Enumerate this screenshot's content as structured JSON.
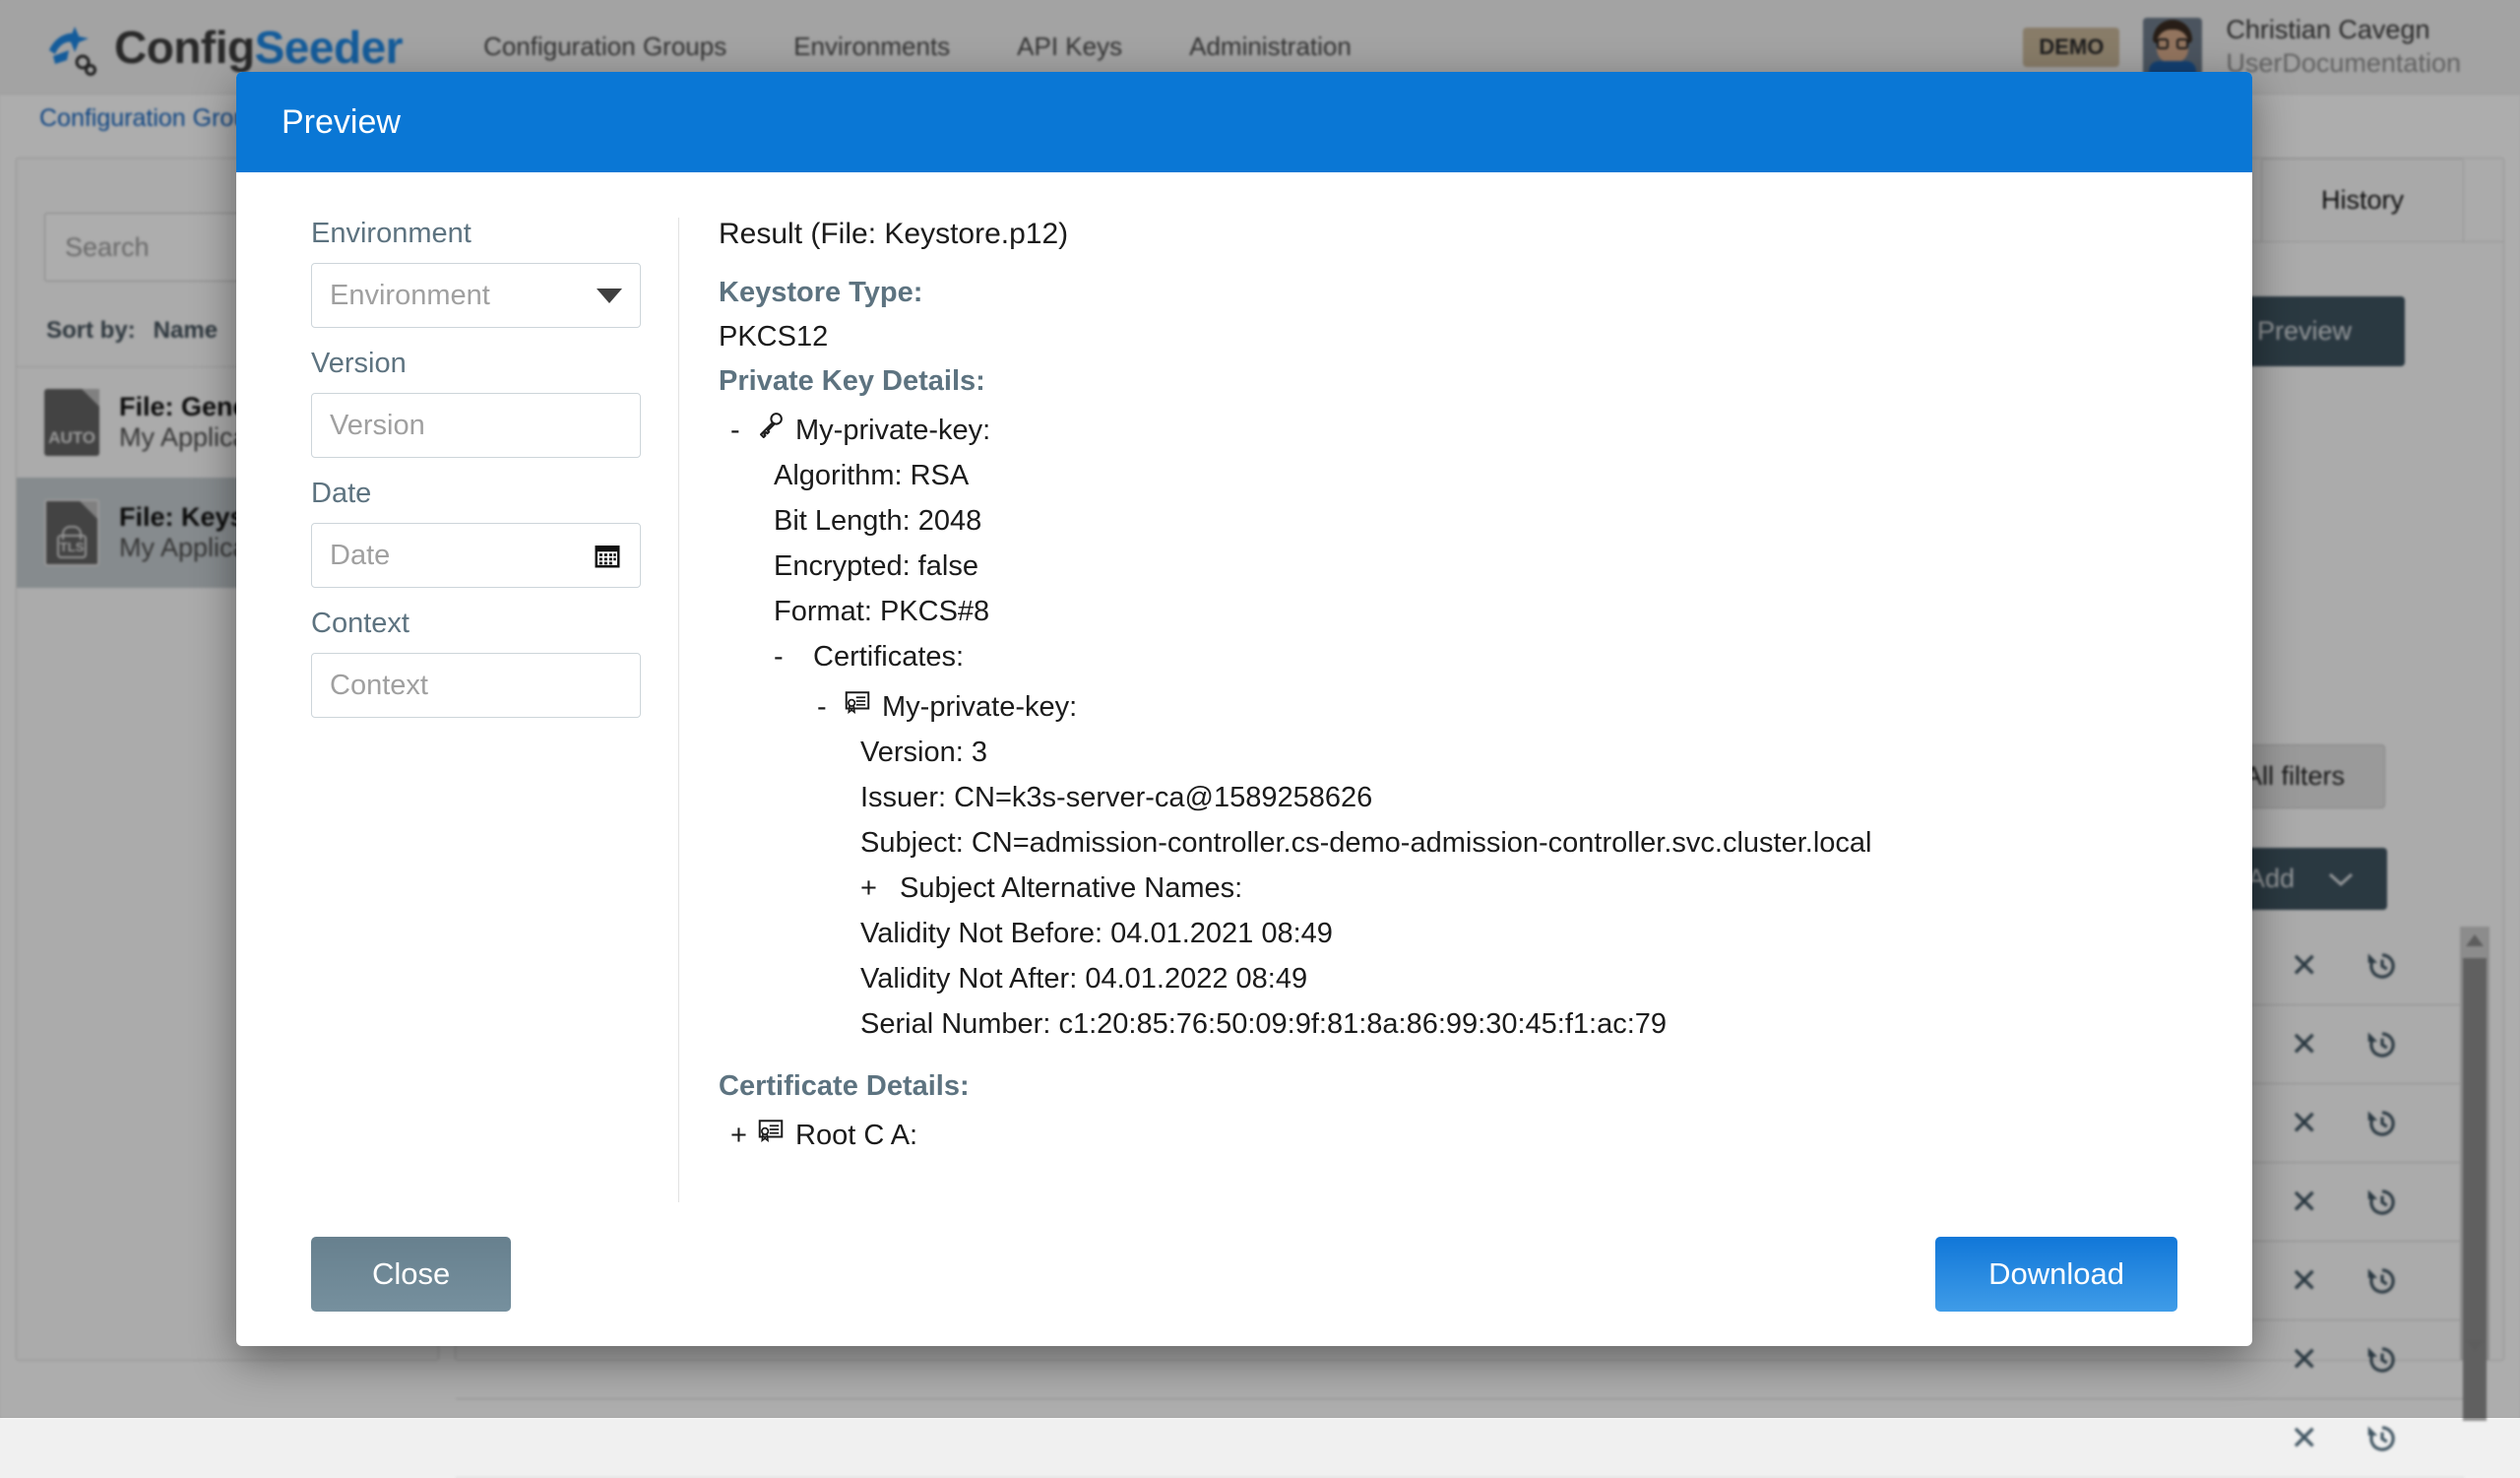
{
  "header": {
    "brand_primary": "Config",
    "brand_secondary": "Seeder",
    "logo_icon": "configseeder-logo-icon",
    "nav": [
      {
        "label": "Configuration Groups"
      },
      {
        "label": "Environments"
      },
      {
        "label": "API Keys"
      },
      {
        "label": "Administration"
      }
    ],
    "demo_badge": "DEMO",
    "user_name": "Christian Cavegn",
    "user_org": "UserDocumentation",
    "avatar_icon": "user-avatar"
  },
  "background": {
    "breadcrumb": "Configuration Groups",
    "search_placeholder": "Search",
    "sort_label": "Sort by:",
    "sort_value": "Name",
    "files": [
      {
        "title": "File: General",
        "subtitle": "My Application",
        "badge": "AUTO",
        "icon": "file-auto-icon",
        "selected": false
      },
      {
        "title": "File: Keystore",
        "subtitle": "My Application",
        "badge": "TLS",
        "icon": "file-tls-icon",
        "selected": true
      }
    ],
    "tabs": [
      {
        "label": "History",
        "active": true
      }
    ],
    "preview_button": "Preview",
    "all_filters_button": "All filters",
    "add_button": "Add",
    "row_delete_icon": "close-icon",
    "row_restore_icon": "restore-history-icon",
    "row_count": 7
  },
  "modal": {
    "title": "Preview",
    "form": {
      "environment": {
        "label": "Environment",
        "placeholder": "Environment",
        "value": "",
        "icon": "chevron-down-icon"
      },
      "version": {
        "label": "Version",
        "placeholder": "Version",
        "value": ""
      },
      "date": {
        "label": "Date",
        "placeholder": "Date",
        "value": "",
        "icon": "calendar-icon"
      },
      "context": {
        "label": "Context",
        "placeholder": "Context",
        "value": ""
      }
    },
    "result": {
      "title": "Result (File: Keystore.p12)",
      "keystore_type_label": "Keystore Type:",
      "keystore_type_value": "PKCS12",
      "private_key_label": "Private Key Details:",
      "private_key_node": "My-private-key:",
      "private_key_toggle": "-",
      "private_key_icon": "key-icon",
      "algorithm": "Algorithm: RSA",
      "bit_length": "Bit Length: 2048",
      "encrypted": "Encrypted: false",
      "format": "Format: PKCS#8",
      "certificates_label": "Certificates:",
      "certificates_toggle": "-",
      "cert_node": "My-private-key:",
      "cert_node_toggle": "-",
      "cert_node_icon": "certificate-icon",
      "cert_version": "Version: 3",
      "cert_issuer": "Issuer: CN=k3s-server-ca@1589258626",
      "cert_subject": "Subject: CN=admission-controller.cs-demo-admission-controller.svc.cluster.local",
      "san_label": "Subject Alternative Names:",
      "san_toggle": "+",
      "validity_not_before": "Validity Not Before: 04.01.2021 08:49",
      "validity_not_after": "Validity Not After: 04.01.2022 08:49",
      "serial_number": "Serial Number: c1:20:85:76:50:09:9f:81:8a:86:99:30:45:f1:ac:79",
      "certificate_details_label": "Certificate Details:",
      "root_ca_node": "Root C A:",
      "root_ca_toggle": "+",
      "root_ca_icon": "certificate-icon"
    },
    "footer": {
      "close_label": "Close",
      "download_label": "Download"
    }
  },
  "colors": {
    "accent_blue": "#0a77d5",
    "brand_blue": "#1e88e5",
    "section_heading": "#5d7380",
    "close_button": "#6f8895",
    "download_button": "#1e8de4",
    "demo_badge": "#c9b79a"
  }
}
